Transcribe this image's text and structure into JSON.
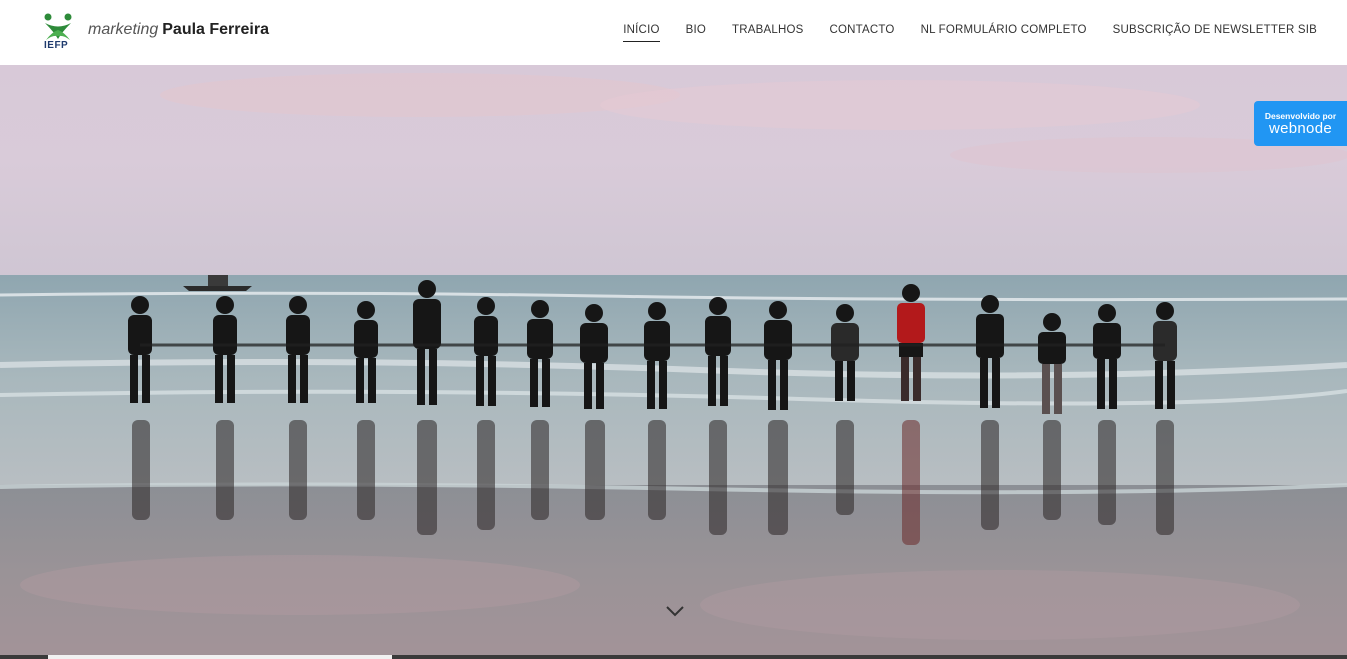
{
  "header": {
    "logo_text": "IEFP",
    "title_light": "marketing",
    "title_strong": "Paula Ferreira"
  },
  "nav": {
    "items": [
      {
        "label": "INÍCIO",
        "active": true
      },
      {
        "label": "BIO"
      },
      {
        "label": "TRABALHOS"
      },
      {
        "label": "CONTACTO"
      },
      {
        "label": "NL FORMULÁRIO COMPLETO"
      },
      {
        "label": "SUBSCRIÇÃO DE NEWSLETTER SIB"
      }
    ]
  },
  "badge": {
    "small": "Desenvolvido por",
    "big": "webnode"
  },
  "hero": {
    "icon": "chevron-down-icon"
  },
  "colors": {
    "badge": "#2196f3",
    "logo_green": "#2e8b3a",
    "logo_blue": "#1f3b6e"
  }
}
